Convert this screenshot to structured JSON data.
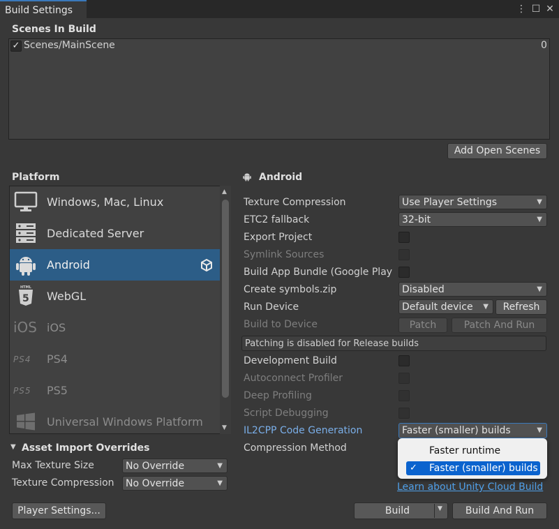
{
  "window": {
    "tab_title": "Build Settings",
    "menu_icon": "⋮",
    "maximize_icon": "☐",
    "close_icon": "✕"
  },
  "scenes": {
    "title": "Scenes In Build",
    "items": [
      {
        "checked": true,
        "path": "Scenes/MainScene",
        "index": "0"
      }
    ],
    "add_open_scenes": "Add Open Scenes"
  },
  "platform": {
    "title": "Platform",
    "items": [
      {
        "label": "Windows, Mac, Linux",
        "icon": "monitor-icon",
        "selected": false,
        "dim": false
      },
      {
        "label": "Dedicated Server",
        "icon": "server-icon",
        "selected": false,
        "dim": false
      },
      {
        "label": "Android",
        "icon": "android-icon",
        "selected": true,
        "dim": false
      },
      {
        "label": "WebGL",
        "icon": "html5-icon",
        "selected": false,
        "dim": false
      },
      {
        "label": "iOS",
        "icon": "ios-icon",
        "icon_text": "iOS",
        "selected": false,
        "dim": true
      },
      {
        "label": "PS4",
        "icon": "ps4-icon",
        "icon_text": "PS4",
        "selected": false,
        "dim": true
      },
      {
        "label": "PS5",
        "icon": "ps5-icon",
        "icon_text": "PS5",
        "selected": false,
        "dim": true
      },
      {
        "label": "Universal Windows Platform",
        "icon": "windows-icon",
        "selected": false,
        "dim": true
      }
    ]
  },
  "asset_overrides": {
    "title": "Asset Import Overrides",
    "max_texture_size_label": "Max Texture Size",
    "max_texture_size_value": "No Override",
    "texture_compression_label": "Texture Compression",
    "texture_compression_value": "No Override"
  },
  "android": {
    "title": "Android",
    "texture_compression_label": "Texture Compression",
    "texture_compression_value": "Use Player Settings",
    "etc2_label": "ETC2 fallback",
    "etc2_value": "32-bit",
    "export_project_label": "Export Project",
    "symlink_label": "Symlink Sources",
    "app_bundle_label": "Build App Bundle (Google Play",
    "symbols_label": "Create symbols.zip",
    "symbols_value": "Disabled",
    "run_device_label": "Run Device",
    "run_device_value": "Default device",
    "refresh_label": "Refresh",
    "build_to_device_label": "Build to Device",
    "patch_label": "Patch",
    "patch_and_run_label": "Patch And Run",
    "patch_info": "Patching is disabled for Release builds",
    "dev_build_label": "Development Build",
    "autoconnect_label": "Autoconnect Profiler",
    "deep_profiling_label": "Deep Profiling",
    "script_debugging_label": "Script Debugging",
    "il2cpp_label": "IL2CPP Code Generation",
    "il2cpp_value": "Faster (smaller) builds",
    "compression_label": "Compression Method",
    "popup_options": [
      "Faster runtime",
      "Faster (smaller) builds"
    ],
    "popup_selected": 1,
    "cloud_build_link": "Learn about Unity Cloud Build"
  },
  "footer": {
    "player_settings": "Player Settings...",
    "build": "Build",
    "build_and_run": "Build And Run"
  }
}
